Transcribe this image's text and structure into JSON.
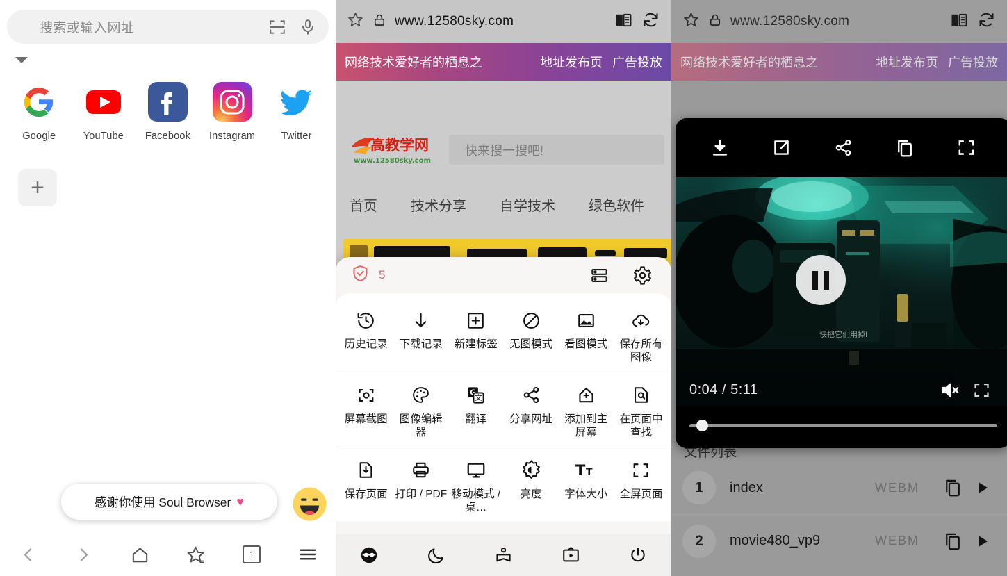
{
  "new_tab": {
    "search": {
      "placeholder": "搜索或输入网址",
      "scan_icon": "scan-icon",
      "mic_icon": "microphone-icon"
    },
    "expand_icon": "chevron-down-icon",
    "shortcuts": [
      {
        "label": "Google",
        "icon": "google-icon"
      },
      {
        "label": "YouTube",
        "icon": "youtube-icon"
      },
      {
        "label": "Facebook",
        "icon": "facebook-icon"
      },
      {
        "label": "Instagram",
        "icon": "instagram-icon"
      },
      {
        "label": "Twitter",
        "icon": "twitter-icon"
      }
    ],
    "add_shortcut_label": "+",
    "toast": {
      "text": "感谢你使用 Soul Browser",
      "heart": "♥",
      "emoji": "grinning-face"
    },
    "bottom_nav": {
      "back": "back-icon",
      "forward": "forward-icon",
      "home": "home-icon",
      "bookmark": "star-icon",
      "tab_count": "1",
      "menu": "hamburger-menu-icon"
    }
  },
  "site": {
    "url": "www.12580sky.com",
    "star_icon": "star-icon",
    "lock_icon": "lock-icon",
    "reader_icon": "reader-mode-icon",
    "reload_icon": "reload-icon",
    "banner": {
      "title": "网络技术爱好者的栖息之",
      "links": [
        "地址发布页",
        "广告投放"
      ]
    },
    "search_placeholder": "快来搜一搜吧!",
    "logo_text": "小高教学网",
    "logo_sub": "www.12580sky.com",
    "nav": [
      "首页",
      "技术分享",
      "自学技术",
      "绿色软件"
    ]
  },
  "menu": {
    "shield_icon": "shield-check-icon",
    "blocked_count": "5",
    "layout_icon": "split-layout-icon",
    "settings_icon": "gear-icon",
    "rows": [
      [
        {
          "label": "历史记录",
          "icon": "history-icon"
        },
        {
          "label": "下载记录",
          "icon": "download-arrow-icon"
        },
        {
          "label": "新建标签",
          "icon": "new-tab-plus-icon"
        },
        {
          "label": "无图模式",
          "icon": "no-image-icon"
        },
        {
          "label": "看图模式",
          "icon": "image-icon"
        },
        {
          "label": "保存所有图像",
          "icon": "cloud-download-icon"
        }
      ],
      [
        {
          "label": "屏幕截图",
          "icon": "screenshot-icon"
        },
        {
          "label": "图像编辑器",
          "icon": "palette-icon"
        },
        {
          "label": "翻译",
          "icon": "translate-icon"
        },
        {
          "label": "分享网址",
          "icon": "share-icon"
        },
        {
          "label": "添加到主屏幕",
          "icon": "add-to-home-icon"
        },
        {
          "label": "在页面中查找",
          "icon": "find-in-page-icon"
        }
      ],
      [
        {
          "label": "保存页面",
          "icon": "save-page-icon"
        },
        {
          "label": "打印 / PDF",
          "icon": "printer-icon"
        },
        {
          "label": "移动模式 / 桌…",
          "icon": "desktop-mode-icon"
        },
        {
          "label": "亮度",
          "icon": "brightness-icon"
        },
        {
          "label": "字体大小",
          "icon": "font-size-icon"
        },
        {
          "label": "全屏页面",
          "icon": "fullscreen-icon"
        }
      ]
    ],
    "footer": [
      {
        "icon": "incognito-icon"
      },
      {
        "icon": "night-mode-moon-icon"
      },
      {
        "icon": "reading-list-icon"
      },
      {
        "icon": "video-tv-icon"
      },
      {
        "icon": "power-exit-icon"
      }
    ]
  },
  "player": {
    "top_actions": [
      {
        "icon": "download-icon"
      },
      {
        "icon": "open-external-icon"
      },
      {
        "icon": "share-icon"
      },
      {
        "icon": "copy-icon"
      },
      {
        "icon": "fullscreen-icon"
      }
    ],
    "state_icon": "pause-icon",
    "current_time": "0:04",
    "duration": "5:11",
    "time_display": "0:04 / 5:11",
    "progress_percent": 2,
    "mute_icon": "muted-volume-icon",
    "fullscreen_icon": "fullscreen-icon",
    "subtitle": "快把它们用掉!"
  },
  "file_list": {
    "title": "文件列表",
    "rows": [
      {
        "index": "1",
        "name": "index",
        "type": "WEBM",
        "copy_icon": "copy-icon",
        "play_icon": "play-icon"
      },
      {
        "index": "2",
        "name": "movie480_vp9",
        "type": "WEBM",
        "copy_icon": "copy-icon",
        "play_icon": "play-icon"
      }
    ]
  }
}
